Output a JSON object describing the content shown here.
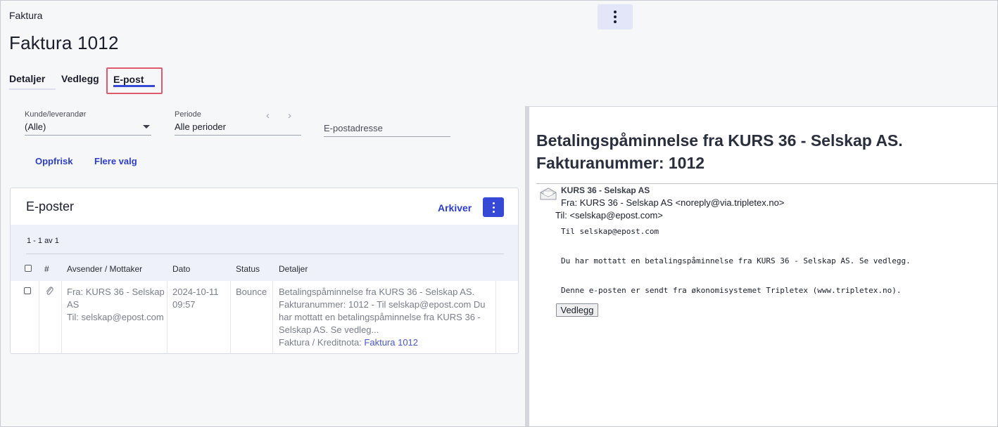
{
  "header": {
    "breadcrumb": "Faktura",
    "title": "Faktura 1012",
    "more_icon": "vertical-dots-icon"
  },
  "tabs": [
    {
      "label": "Detaljer",
      "active": false
    },
    {
      "label": "Vedlegg",
      "active": false
    },
    {
      "label": "E-post",
      "active": true
    }
  ],
  "filters": {
    "customer": {
      "label": "Kunde/leverandør",
      "value": "(Alle)"
    },
    "period": {
      "label": "Periode",
      "value": "Alle perioder",
      "prev": "‹",
      "next": "›"
    },
    "email": {
      "placeholder": "E-postadresse"
    }
  },
  "actions": {
    "refresh": "Oppfrisk",
    "more_options": "Flere valg"
  },
  "emails_card": {
    "title": "E-poster",
    "archive": "Arkiver",
    "count": "1 - 1 av 1",
    "columns": [
      "#",
      "Avsender / Mottaker",
      "Dato",
      "Status",
      "Detaljer"
    ],
    "rows": [
      {
        "sender_line1": "Fra: KURS 36 - Selskap",
        "sender_line2": "AS",
        "sender_line3": "Til: selskap@epost.com",
        "date_line1": "2024-10-11",
        "date_line2": "09:57",
        "status": "Bounce",
        "details_line1": "Betalingspåminnelse fra KURS 36 - Selskap AS.",
        "details_line2": "Fakturanummer: 1012 - Til selskap@epost.com Du",
        "details_line3": "har mottatt en betalingspåminnelse fra KURS 36 -",
        "details_line4": "Selskap AS. Se vedleg...",
        "details_ref_label": "Faktura / Kreditnota:",
        "details_ref_link": "Faktura 1012"
      }
    ]
  },
  "preview": {
    "title": "Betalingspåminnelse fra KURS 36 - Selskap AS. Fakturanummer: 1012",
    "sender_name": "KURS 36 - Selskap AS",
    "from": "Fra: KURS 36 - Selskap AS <noreply@via.tripletex.no>",
    "to": "Til: <selskap@epost.com>",
    "body_line1": "Til selskap@epost.com",
    "body_line2": "Du har mottatt en betalingspåminnelse fra KURS 36 - Selskap AS. Se vedlegg.",
    "body_line3": "Denne e-posten er sendt fra økonomisystemet Tripletex (www.tripletex.no).",
    "attachment_button": "Vedlegg"
  }
}
